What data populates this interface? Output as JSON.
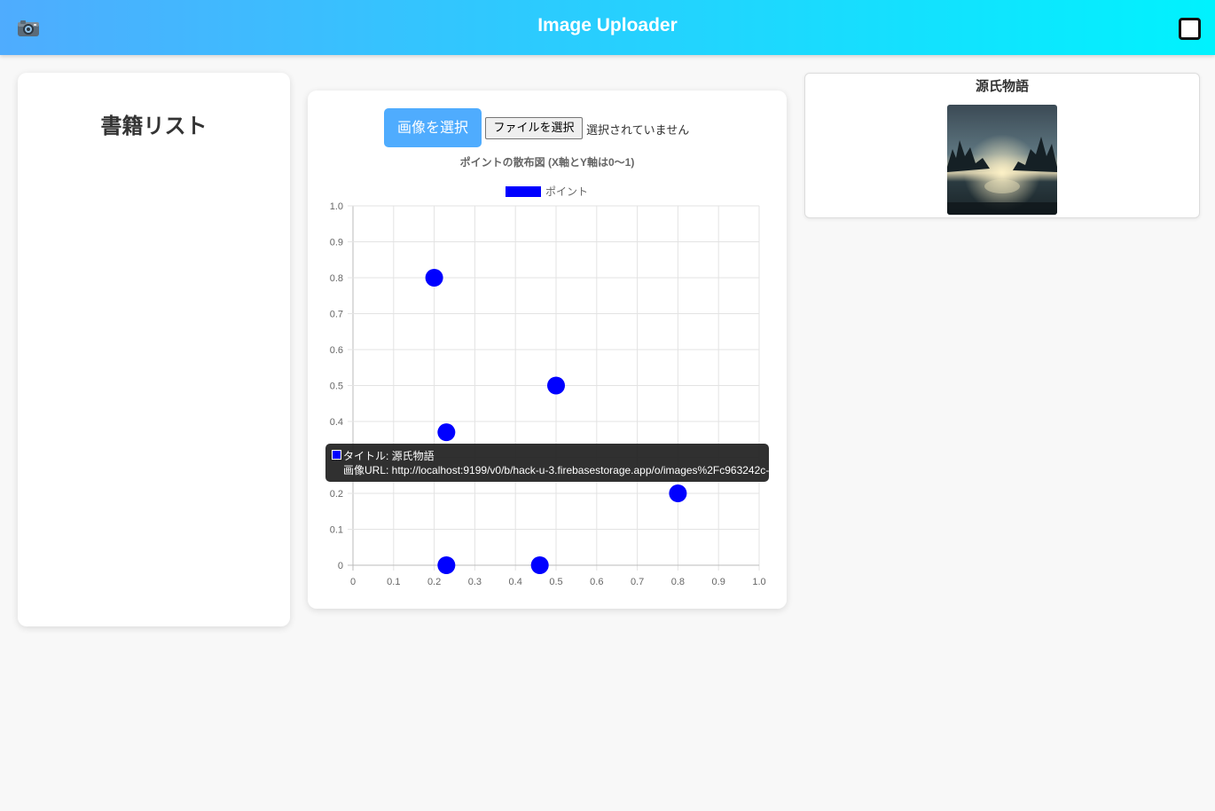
{
  "header": {
    "camera_icon": "camera-icon",
    "title": "Image Uploader",
    "square_icon": "square-icon",
    "gradient": [
      "#4facfe",
      "#00f2fe"
    ]
  },
  "book_panel": {
    "title": "書籍リスト"
  },
  "upload": {
    "select_image_label": "画像を選択",
    "file_button_label": "ファイルを選択",
    "file_status": "選択されていません",
    "accent_color": "#4facfe"
  },
  "chart_data": {
    "type": "scatter",
    "title": "ポイントの散布図 (X軸とY軸は0〜1)",
    "legend": {
      "label": "ポイント",
      "position": "top",
      "color": "#0000ff"
    },
    "x_ticks": [
      "0",
      "0.1",
      "0.2",
      "0.3",
      "0.4",
      "0.5",
      "0.6",
      "0.7",
      "0.8",
      "0.9",
      "1.0"
    ],
    "y_ticks": [
      "0",
      "0.1",
      "0.2",
      "0.3",
      "0.4",
      "0.5",
      "0.6",
      "0.7",
      "0.8",
      "0.9",
      "1.0"
    ],
    "xlim": [
      0,
      1
    ],
    "ylim": [
      0,
      1
    ],
    "grid": true,
    "points": [
      {
        "x": 0.2,
        "y": 0.8
      },
      {
        "x": 0.5,
        "y": 0.5
      },
      {
        "x": 0.23,
        "y": 0.37
      },
      {
        "x": 0.8,
        "y": 0.2
      },
      {
        "x": 0.23,
        "y": 0.0
      },
      {
        "x": 0.46,
        "y": 0.0
      }
    ]
  },
  "tooltip": {
    "line1": "タイトル: 源氏物語",
    "line2": "画像URL: http://localhost:9199/v0/b/hack-u-3.firebasestorage.app/o/images%2Fc963242c-"
  },
  "image_panel": {
    "title": "源氏物語"
  }
}
